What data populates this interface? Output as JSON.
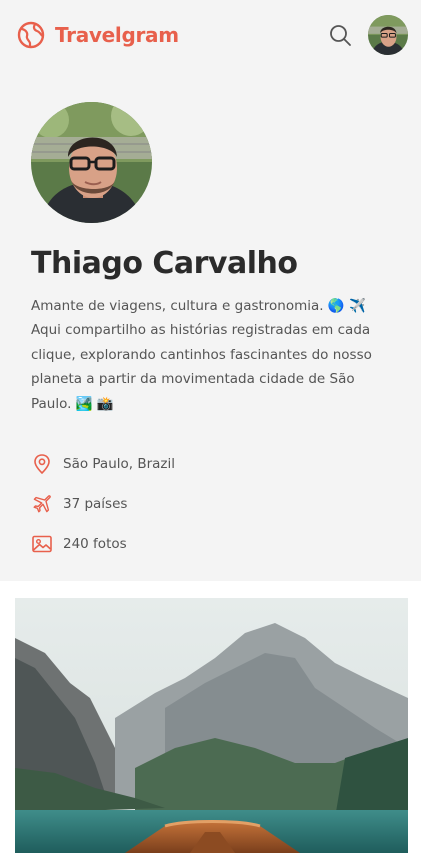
{
  "header": {
    "brand_name": "Travelgram",
    "brand_icon": "globe-icon",
    "search_icon": "search-icon",
    "avatar_alt": "avatar"
  },
  "profile": {
    "name": "Thiago Carvalho",
    "bio": "Amante de viagens, cultura e gastronomia. 🌎 ✈️ Aqui compartilho as histórias registradas em cada clique, explorando cantinhos fascinantes do nosso planeta a partir da movimentada cidade de São Paulo. 🏞️ 📸",
    "location": "São Paulo, Brazil",
    "countries": "37 países",
    "photos": "240 fotos"
  },
  "colors": {
    "accent": "#e8604c",
    "profile_bg": "#f4f4f4",
    "text_dark": "#2b2b2b",
    "text_muted": "#555555"
  }
}
